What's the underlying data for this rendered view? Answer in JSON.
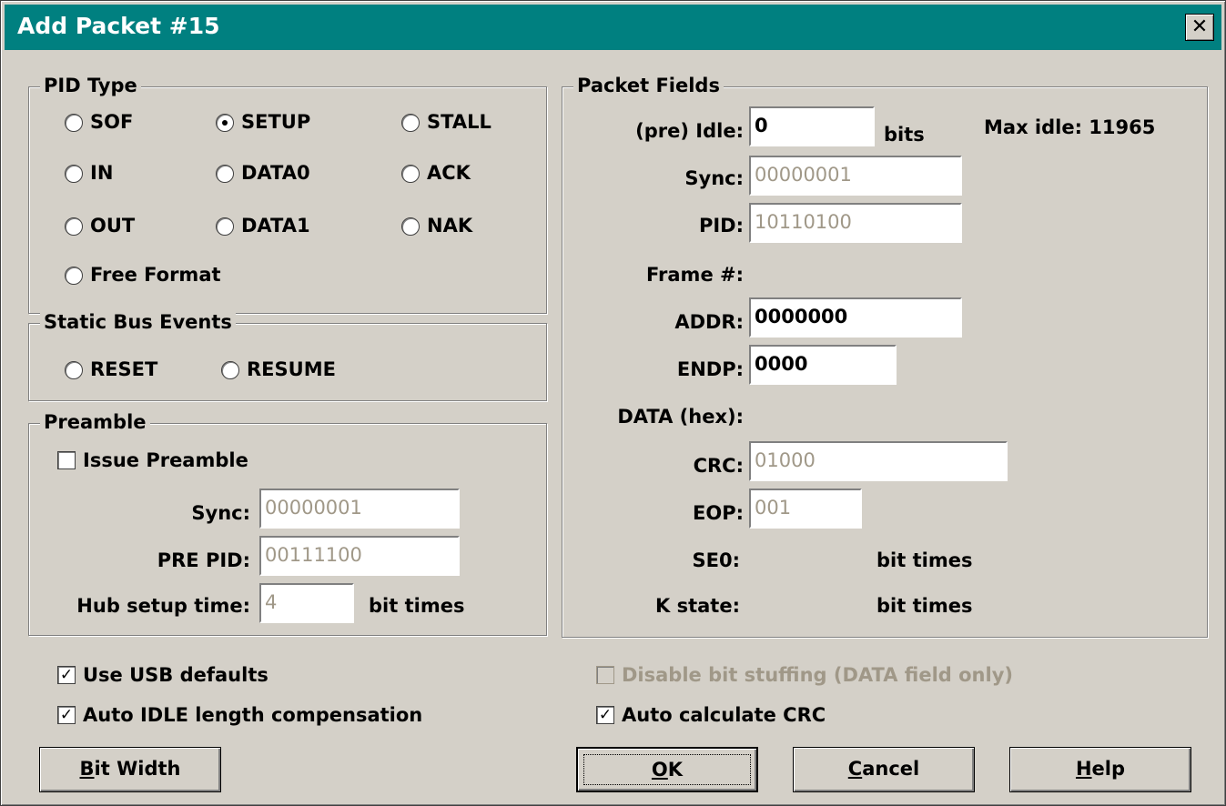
{
  "window": {
    "title": "Add Packet #15",
    "close_label": "✕"
  },
  "pid_type": {
    "legend": "PID Type",
    "options": [
      {
        "label": "SOF",
        "selected": false
      },
      {
        "label": "SETUP",
        "selected": true
      },
      {
        "label": "STALL",
        "selected": false
      },
      {
        "label": "IN",
        "selected": false
      },
      {
        "label": "DATA0",
        "selected": false
      },
      {
        "label": "ACK",
        "selected": false
      },
      {
        "label": "OUT",
        "selected": false
      },
      {
        "label": "DATA1",
        "selected": false
      },
      {
        "label": "NAK",
        "selected": false
      },
      {
        "label": "Free Format",
        "selected": false
      }
    ]
  },
  "static_bus_events": {
    "legend": "Static Bus Events",
    "options": [
      {
        "label": "RESET",
        "selected": false
      },
      {
        "label": "RESUME",
        "selected": false
      }
    ]
  },
  "preamble": {
    "legend": "Preamble",
    "issue_preamble": {
      "label": "Issue Preamble",
      "checked": false
    },
    "sync_label": "Sync:",
    "sync_value": "00000001",
    "pre_pid_label": "PRE PID:",
    "pre_pid_value": "00111100",
    "hub_setup_label": "Hub setup time:",
    "hub_setup_value": "4",
    "hub_setup_unit": "bit times"
  },
  "packet_fields": {
    "legend": "Packet Fields",
    "pre_idle_label": "(pre) Idle:",
    "pre_idle_value": "0",
    "pre_idle_unit": "bits",
    "max_idle": "Max idle: 11965",
    "sync_label": "Sync:",
    "sync_value": "00000001",
    "pid_label": "PID:",
    "pid_value": "10110100",
    "frame_label": "Frame #:",
    "addr_label": "ADDR:",
    "addr_value": "0000000",
    "endp_label": "ENDP:",
    "endp_value": "0000",
    "data_label": "DATA (hex):",
    "crc_label": "CRC:",
    "crc_value": "01000",
    "eop_label": "EOP:",
    "eop_value": "001",
    "se0_label": "SE0:",
    "se0_unit": "bit times",
    "kstate_label": "K state:",
    "kstate_unit": "bit times"
  },
  "options": {
    "use_usb_defaults": {
      "label": "Use USB defaults",
      "checked": true
    },
    "auto_idle": {
      "label": "Auto IDLE length compensation",
      "checked": true
    },
    "disable_bit_stuffing": {
      "label": "Disable bit stuffing (DATA field only)",
      "checked": false,
      "enabled": false
    },
    "auto_crc": {
      "label": "Auto calculate CRC",
      "checked": true
    }
  },
  "buttons": {
    "bit_width": {
      "mnemonic": "B",
      "rest": "it Width"
    },
    "ok": {
      "mnemonic": "O",
      "rest": "K"
    },
    "cancel": {
      "mnemonic": "C",
      "rest": "ancel"
    },
    "help": {
      "mnemonic": "H",
      "rest": "elp"
    }
  }
}
